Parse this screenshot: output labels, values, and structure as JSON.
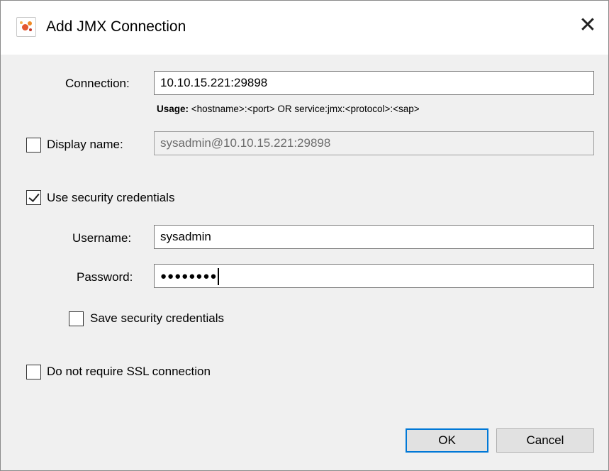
{
  "window": {
    "title": "Add JMX Connection",
    "close_glyph": "✕"
  },
  "connection": {
    "label": "Connection:",
    "value": "10.10.15.221:29898",
    "usage_bold": "Usage:",
    "usage_text": " <hostname>:<port> OR service:jmx:<protocol>:<sap>"
  },
  "display_name": {
    "label": "Display name:",
    "checked": false,
    "value": "sysadmin@10.10.15.221:29898",
    "disabled": true
  },
  "security": {
    "label": "Use security credentials",
    "checked": true,
    "username_label": "Username:",
    "username_value": "sysadmin",
    "password_label": "Password:",
    "password_mask": "●●●●●●●●",
    "save_label": "Save security credentials",
    "save_checked": false
  },
  "ssl": {
    "label": "Do not require SSL connection",
    "checked": false
  },
  "buttons": {
    "ok": "OK",
    "cancel": "Cancel"
  },
  "icons": {
    "app": "visualvm-app-icon",
    "close": "close-icon",
    "check": "check-icon"
  },
  "colors": {
    "default_button_border": "#0078d7",
    "dialog_background": "#f0f0f0"
  }
}
